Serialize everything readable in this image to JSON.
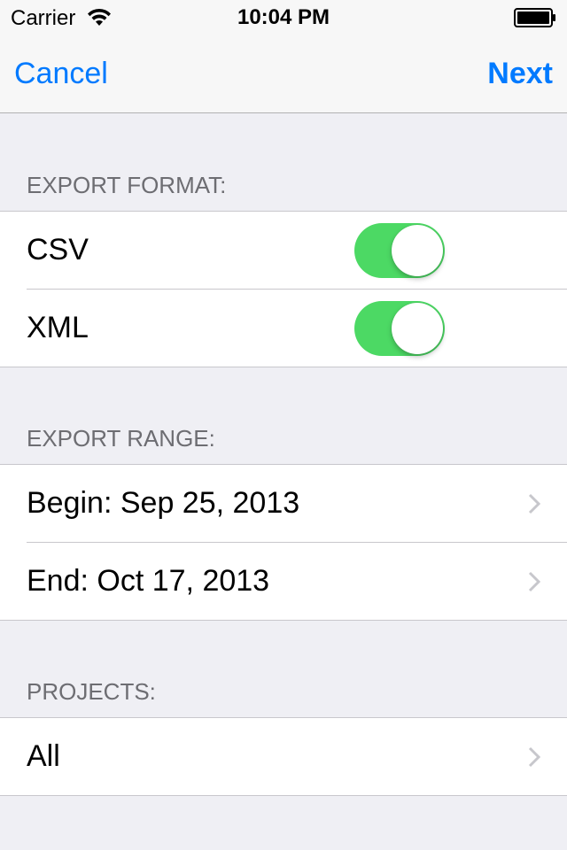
{
  "status_bar": {
    "carrier": "Carrier",
    "time": "10:04 PM"
  },
  "nav": {
    "cancel_label": "Cancel",
    "next_label": "Next"
  },
  "sections": {
    "format": {
      "header": "EXPORT FORMAT:",
      "rows": [
        {
          "label": "CSV",
          "toggle_on": true
        },
        {
          "label": "XML",
          "toggle_on": true
        }
      ]
    },
    "range": {
      "header": "EXPORT RANGE:",
      "rows": [
        {
          "label": "Begin: Sep 25, 2013"
        },
        {
          "label": "End: Oct 17, 2013"
        }
      ]
    },
    "projects": {
      "header": "PROJECTS:",
      "rows": [
        {
          "label": "All"
        }
      ]
    }
  },
  "colors": {
    "tint": "#007aff",
    "toggle_on": "#4cd964",
    "background": "#efeff4",
    "section_header": "#6d6d72",
    "separator": "#c8c7cc",
    "chevron": "#c7c7cc"
  },
  "icons": {
    "wifi": "wifi-icon",
    "battery": "battery-icon",
    "chevron": "chevron-right-icon"
  }
}
